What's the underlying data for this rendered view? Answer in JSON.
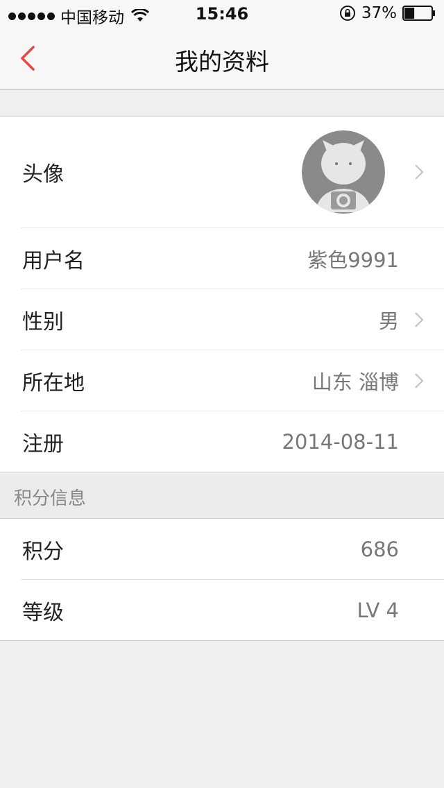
{
  "status_bar": {
    "carrier": "中国移动",
    "time": "15:46",
    "battery_percent": "37%",
    "battery_level": 0.37
  },
  "nav": {
    "title": "我的资料"
  },
  "profile": {
    "avatar": {
      "label": "头像"
    },
    "username": {
      "label": "用户名",
      "value": "紫色9991"
    },
    "gender": {
      "label": "性别",
      "value": "男"
    },
    "location": {
      "label": "所在地",
      "value": "山东 淄博"
    },
    "registered": {
      "label": "注册",
      "value": "2014-08-11"
    }
  },
  "points_section": {
    "header": "积分信息",
    "points": {
      "label": "积分",
      "value": "686"
    },
    "level": {
      "label": "等级",
      "value": "LV 4"
    }
  },
  "colors": {
    "accent": "#e8473e",
    "background": "#efefef",
    "row_background": "#ffffff"
  }
}
